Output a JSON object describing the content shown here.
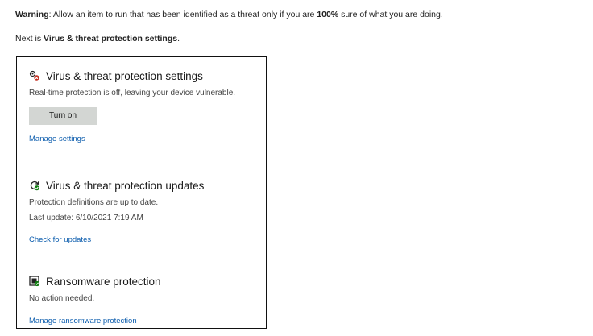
{
  "doc": {
    "warning_label": "Warning",
    "warning_text_1": ": Allow an item to run that has been identified as a threat only if you are ",
    "warning_bold": "100%",
    "warning_text_2": " sure of what you are doing.",
    "next_prefix": "Next is ",
    "next_bold": "Virus & threat protection settings",
    "next_suffix": "."
  },
  "panel": {
    "settings": {
      "icon": "virus-settings-icon",
      "title": "Virus & threat protection settings",
      "description": "Real-time protection is off, leaving your device vulnerable.",
      "button_label": "Turn on",
      "link_label": "Manage settings"
    },
    "updates": {
      "icon": "refresh-check-icon",
      "title": "Virus & threat protection updates",
      "description": "Protection definitions are up to date.",
      "last_update": "Last update: 6/10/2021 7:19 AM",
      "link_label": "Check for updates"
    },
    "ransomware": {
      "icon": "ransomware-shield-icon",
      "title": "Ransomware protection",
      "description": "No action needed.",
      "link_label": "Manage ransomware protection"
    }
  },
  "colors": {
    "link": "#0b5cad",
    "button_bg": "#d3d6d3",
    "alert_red": "#c42b1c",
    "ok_green": "#107c10"
  }
}
